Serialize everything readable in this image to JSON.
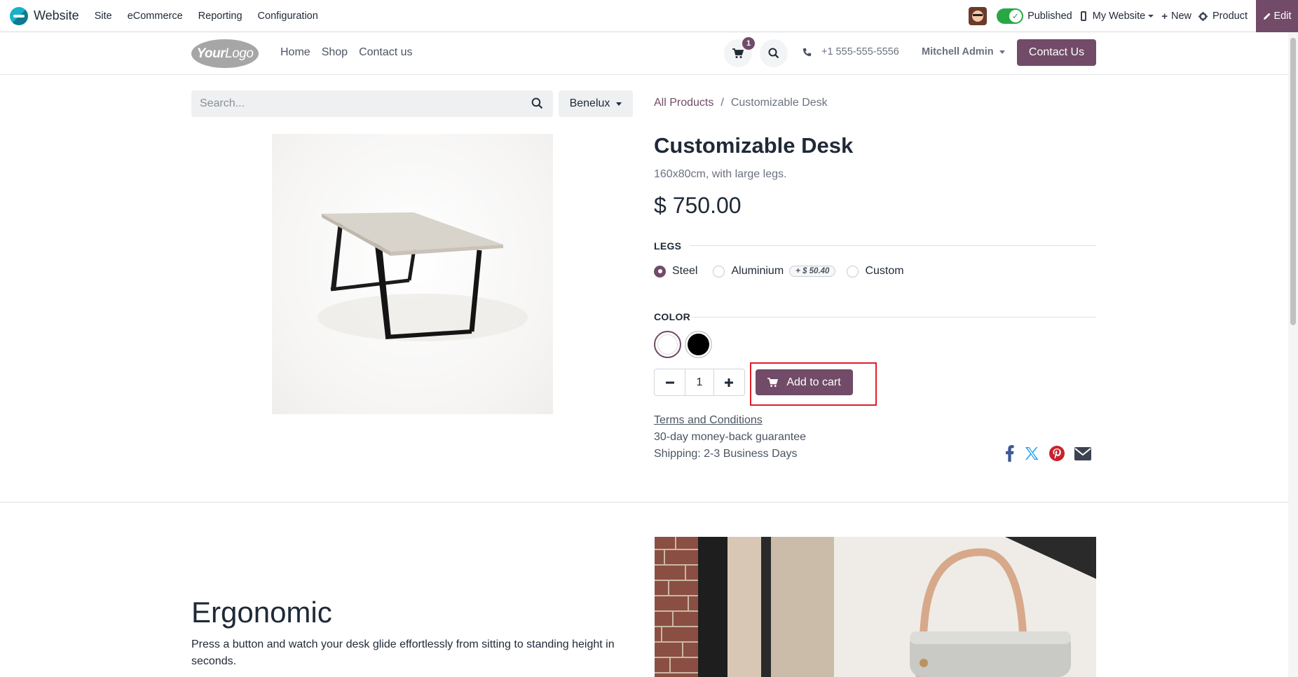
{
  "admin_bar": {
    "app_name": "Website",
    "menu": [
      "Site",
      "eCommerce",
      "Reporting",
      "Configuration"
    ],
    "published_label": "Published",
    "website_selector": "My Website",
    "new_label": "New",
    "product_label": "Product",
    "edit_label": "Edit"
  },
  "site_header": {
    "logo_text_bold": "Your",
    "logo_text": "Logo",
    "nav": [
      "Home",
      "Shop",
      "Contact us"
    ],
    "cart_count": "1",
    "phone": "+1 555-555-5556",
    "user": "Mitchell Admin",
    "contact_button": "Contact Us"
  },
  "shop": {
    "search_placeholder": "Search...",
    "pricelist": "Benelux",
    "breadcrumb": {
      "parent": "All Products",
      "separator": "/",
      "current": "Customizable Desk"
    }
  },
  "product": {
    "name": "Customizable Desk",
    "description": "160x80cm, with large legs.",
    "price": "$ 750.00",
    "attributes": {
      "legs": {
        "label": "LEGS",
        "options": [
          {
            "label": "Steel",
            "selected": true
          },
          {
            "label": "Aluminium",
            "extra": "+ $ 50.40"
          },
          {
            "label": "Custom"
          }
        ]
      },
      "color": {
        "label": "COLOR",
        "options": [
          {
            "name": "white",
            "color": "#ffffff",
            "selected": true
          },
          {
            "name": "black",
            "color": "#000000"
          }
        ]
      }
    },
    "quantity": "1",
    "add_to_cart": "Add to cart",
    "terms": "Terms and Conditions",
    "guarantee": "30-day money-back guarantee",
    "shipping": "Shipping: 2-3 Business Days"
  },
  "section": {
    "title": "Ergonomic",
    "text": "Press a button and watch your desk glide effortlessly from sitting to standing height in seconds."
  },
  "colors": {
    "brand": "#714b67",
    "highlight": "#e11d2a",
    "published": "#28a745"
  },
  "icons": {
    "facebook": "facebook-icon",
    "x": "x-twitter-icon",
    "pinterest": "pinterest-icon",
    "email": "envelope-icon"
  }
}
